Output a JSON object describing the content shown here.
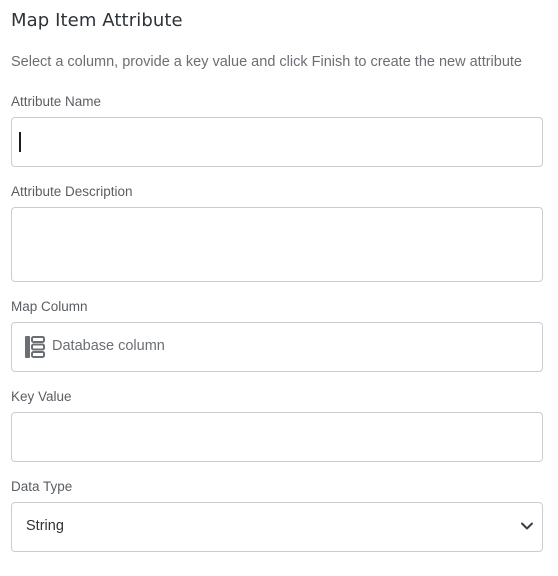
{
  "dialog": {
    "title": "Map Item Attribute",
    "description": "Select a column, provide a key value and click Finish to create the new attribute"
  },
  "fields": {
    "attribute_name": {
      "label": "Attribute Name",
      "value": ""
    },
    "attribute_description": {
      "label": "Attribute Description",
      "value": ""
    },
    "map_column": {
      "label": "Map Column",
      "placeholder": "Database column",
      "icon": "database-column-icon"
    },
    "key_value": {
      "label": "Key Value",
      "value": ""
    },
    "data_type": {
      "label": "Data Type",
      "selected": "String",
      "icon": "chevron-down-icon"
    }
  },
  "colors": {
    "border": "#c9ccd0",
    "title": "#2e3338",
    "muted_text": "#6b6f73",
    "icon": "#6b6f73"
  }
}
